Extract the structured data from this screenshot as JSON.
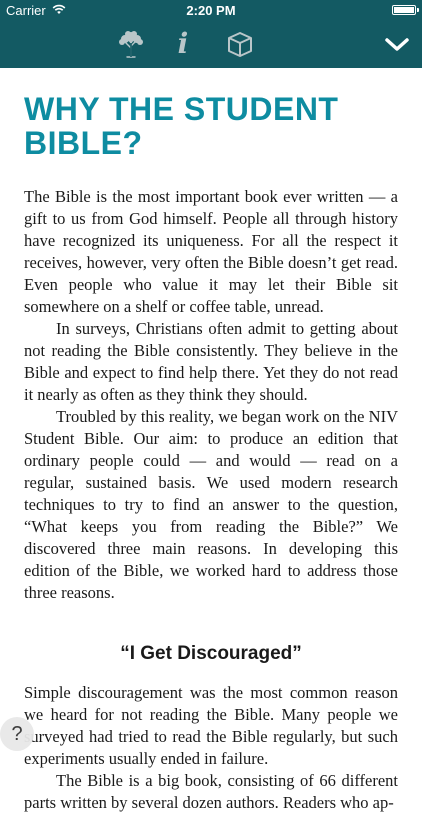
{
  "statusbar": {
    "carrier": "Carrier",
    "time": "2:20 PM"
  },
  "toolbar": {
    "icons": [
      "tree-icon",
      "info-icon",
      "box-icon",
      "chevron-down-icon"
    ],
    "info_glyph": "i"
  },
  "article": {
    "title": "WHY THE STUDENT BIBLE?",
    "paragraphs": [
      "The Bible is the most important book ever written — a gift to us from God himself. People all through history have recognized its uniqueness. For all the respect it receives, however, very often the Bible doesn’t get read. Even people who value it may let their Bible sit somewhere on a shelf or coffee table, unread.",
      "In surveys, Christians often admit to getting about not reading the Bible consistently. They believe in the Bible and expect to find help there. Yet they do not read it nearly as often as they think they should.",
      "Troubled by this reality, we began work on the NIV Student Bible. Our aim: to produce an edition that ordinary people could — and would — read on a regular, sustained basis. We used modern research techniques to try to find an answer to the question, “What keeps you from reading the Bible?” We discovered three main reasons. In developing this edition of the Bible, we worked hard to address those three reasons."
    ],
    "section_heading": "“I Get Discouraged”",
    "section_paragraphs": [
      "Simple discouragement was the most common reason we heard for not reading the Bible. Many people we surveyed had tried to read the Bible regularly, but such experiments usually ended in failure.",
      "The Bible is a big book, consisting of 66 different parts written by several dozen authors. Readers who ap-"
    ]
  },
  "help": {
    "label": "?"
  }
}
